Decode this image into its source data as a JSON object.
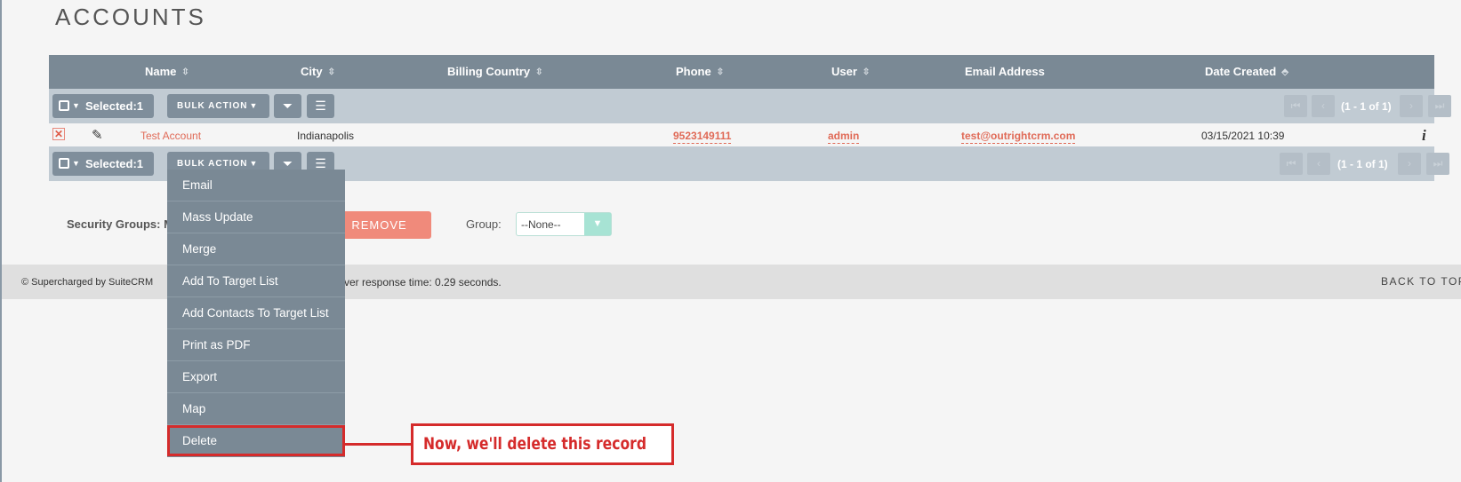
{
  "page": {
    "title": "ACCOUNTS"
  },
  "table": {
    "columns": [
      {
        "label": "Name",
        "sortable": true
      },
      {
        "label": "City",
        "sortable": true
      },
      {
        "label": "Billing Country",
        "sortable": true
      },
      {
        "label": "Phone",
        "sortable": true
      },
      {
        "label": "User",
        "sortable": true
      },
      {
        "label": "Email Address",
        "sortable": false
      },
      {
        "label": "Date Created",
        "sortable": true
      }
    ],
    "rows": [
      {
        "name": "Test Account",
        "city": "Indianapolis",
        "billing_country": "",
        "phone": "9523149111",
        "user": "admin",
        "email": "test@outrightcrm.com",
        "date_created": "03/15/2021 10:39"
      }
    ]
  },
  "toolbar": {
    "selected_label": "Selected:1",
    "bulk_action_label": "BULK ACTION",
    "pagination_text": "(1 - 1 of 1)"
  },
  "bulk_menu": {
    "items": [
      "Email",
      "Mass Update",
      "Merge",
      "Add To Target List",
      "Add Contacts To Target List",
      "Print as PDF",
      "Export",
      "Map",
      "Delete"
    ],
    "highlighted": "Delete"
  },
  "security": {
    "label_visible": "Security Groups: M",
    "remove_label": "REMOVE",
    "group_label": "Group:",
    "group_value": "--None--"
  },
  "footer": {
    "credit": "© Supercharged by SuiteCRM",
    "response_time": "ver response time: 0.29 seconds.",
    "back_to_top": "BACK TO TOP ⌃"
  },
  "annotation": {
    "callout_text": "Now, we'll delete this record",
    "color": "#d52b2b"
  },
  "colors": {
    "header_bg": "#7a8995",
    "toolbar_bg": "#c1cbd3",
    "link": "#e06a57",
    "remove_button": "#f08a7b"
  }
}
